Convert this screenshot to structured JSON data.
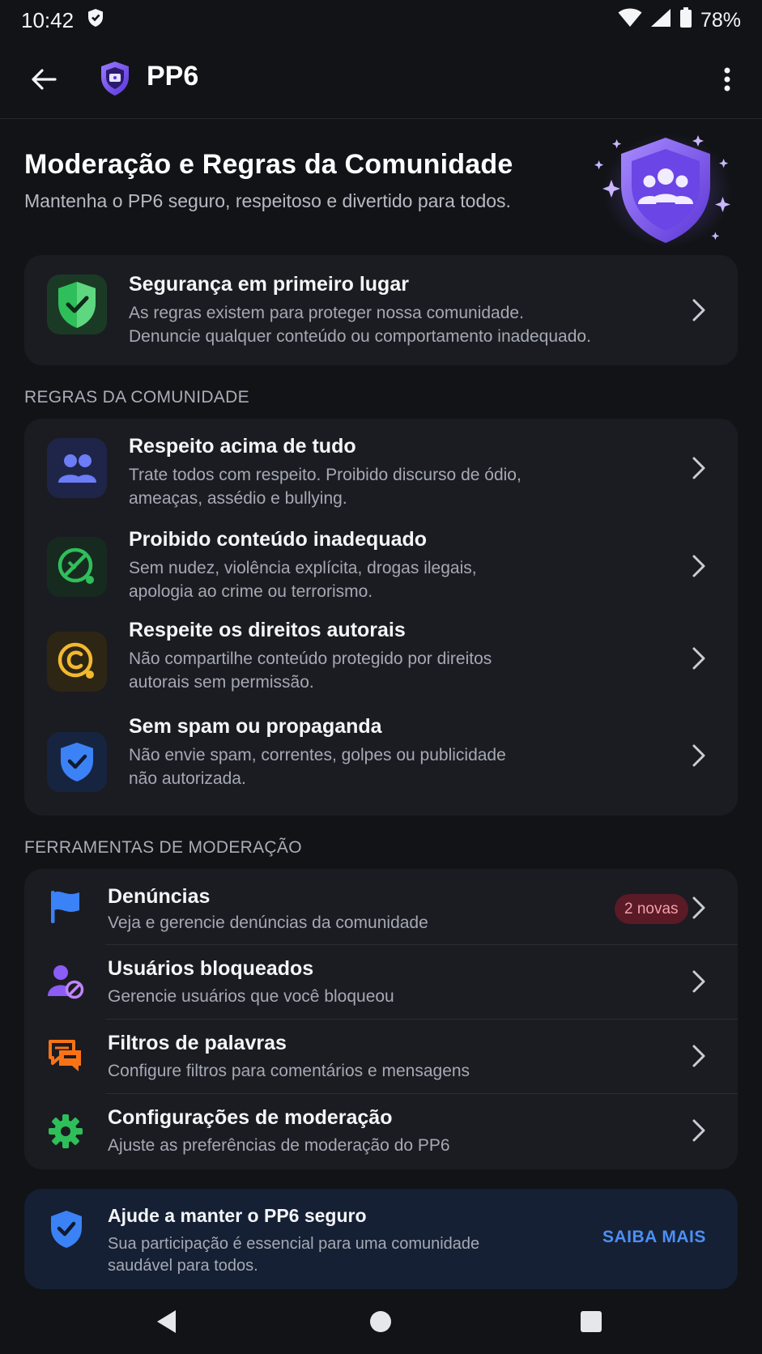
{
  "status_bar": {
    "time": "10:42",
    "battery": "78%"
  },
  "app_bar": {
    "title": "PP6"
  },
  "hero": {
    "title": "Moderação e Regras da Comunidade",
    "subtitle": "Mantenha o PP6 seguro, respeitoso e divertido para todos."
  },
  "safety": {
    "title": "Segurança em primeiro lugar",
    "line1": "As regras existem para proteger nossa comunidade.",
    "line2": "Denuncie qualquer conteúdo ou comportamento inadequado."
  },
  "rules_section": {
    "label": "REGRAS DA COMUNIDADE",
    "items": [
      {
        "title": "Respeito acima de tudo",
        "line1": "Trate todos com respeito. Proibido discurso de ódio,",
        "line2": "ameaças, assédio e bullying."
      },
      {
        "title": "Proibido conteúdo inadequado",
        "line1": "Sem nudez, violência explícita, drogas ilegais,",
        "line2": "apologia ao crime ou terrorismo."
      },
      {
        "title": "Respeite os direitos autorais",
        "line1": "Não compartilhe conteúdo protegido por direitos",
        "line2": "autorais sem permissão."
      },
      {
        "title": "Sem spam ou propaganda",
        "line1": "Não envie spam, correntes, golpes ou publicidade",
        "line2": "não autorizada."
      }
    ]
  },
  "tools_section": {
    "label": "FERRAMENTAS DE MODERAÇÃO",
    "items": [
      {
        "title": "Denúncias",
        "desc": "Veja e gerencie denúncias da comunidade",
        "badge": "2 novas"
      },
      {
        "title": "Usuários bloqueados",
        "desc": "Gerencie usuários que você bloqueou"
      },
      {
        "title": "Filtros de palavras",
        "desc": "Configure filtros para comentários e mensagens"
      },
      {
        "title": "Configurações de moderação",
        "desc": "Ajuste as preferências de moderação do PP6"
      }
    ]
  },
  "help": {
    "title": "Ajude a manter o PP6 seguro",
    "line1": "Sua participação é essencial para uma comunidade",
    "line2": "saudável para todos.",
    "action": "SAIBA MAIS"
  },
  "icons": {
    "status": [
      "shield-status-icon",
      "wifi-icon",
      "signal-icon",
      "battery-icon"
    ],
    "app_bar": [
      "back-arrow-icon",
      "app-shield-logo",
      "more-vert-icon"
    ],
    "rules": [
      "people-icon",
      "prohibited-icon",
      "copyright-icon",
      "shield-check-icon"
    ],
    "tools": [
      "flag-icon",
      "blocked-user-icon",
      "chat-filter-icon",
      "gear-icon"
    ],
    "nav": [
      "back-triangle-icon",
      "home-circle-icon",
      "recents-square-icon"
    ]
  },
  "colors": {
    "background": "#121317",
    "card": "#1b1c22",
    "accent_blue": "#4d8ff5",
    "badge_bg": "#5a1a26",
    "badge_text": "#f3a0aa",
    "shield_purple": "#7c5cf0",
    "safety_green": "#2fbf5a"
  }
}
